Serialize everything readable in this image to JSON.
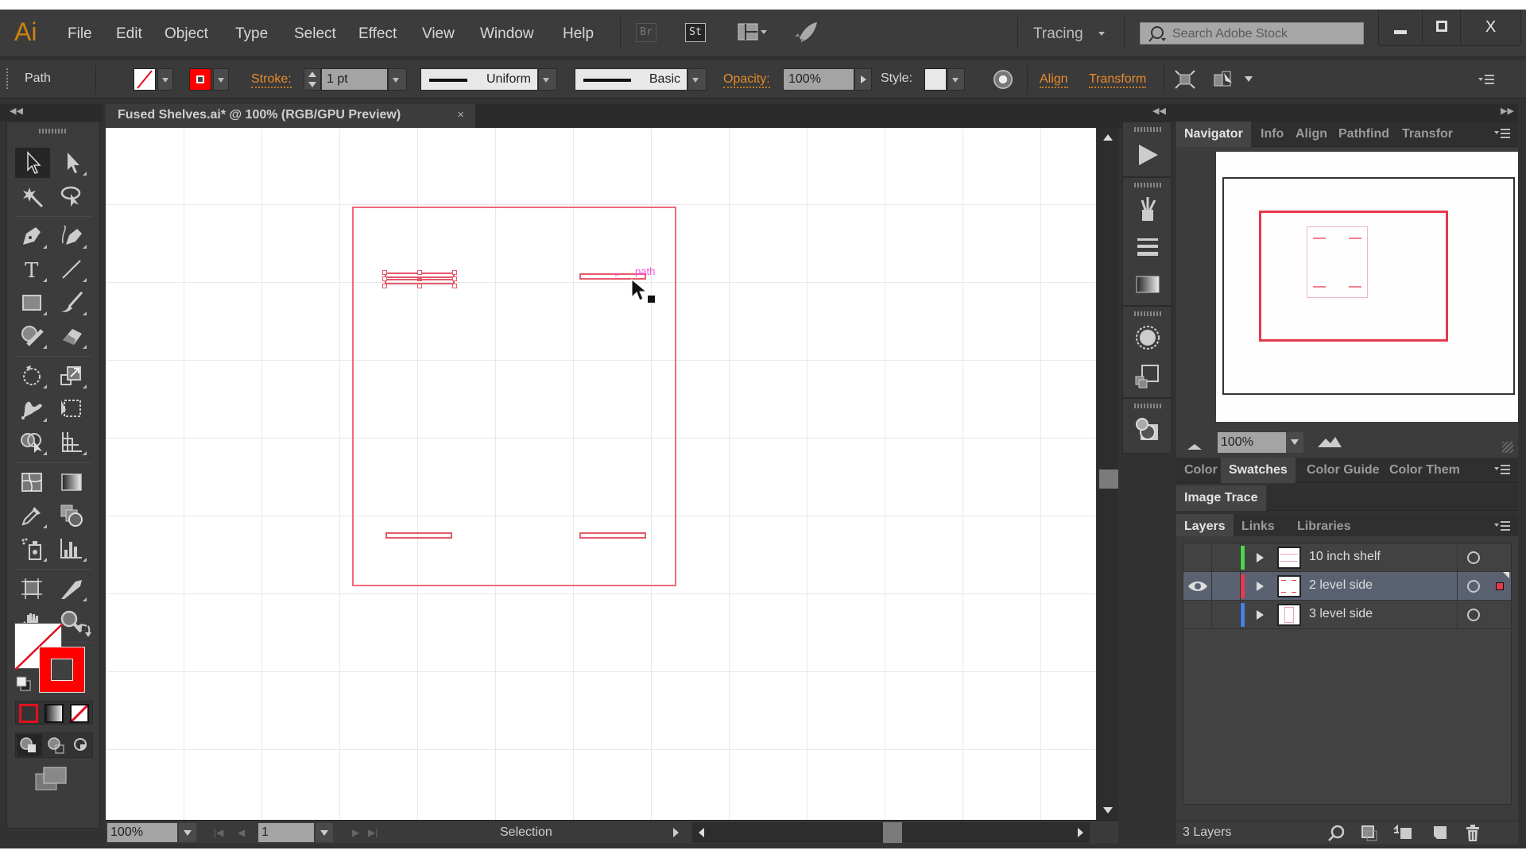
{
  "app": {
    "logo": "Ai",
    "menu": [
      "File",
      "Edit",
      "Object",
      "Type",
      "Select",
      "Effect",
      "View",
      "Window",
      "Help"
    ],
    "bridge_label": "Br",
    "stock_label": "St",
    "workspace": "Tracing",
    "search_placeholder": "Search Adobe Stock",
    "window_buttons": {
      "minimize": "▁",
      "maximize": "□",
      "close": "X"
    }
  },
  "control_bar": {
    "selection_type": "Path",
    "stroke_label": "Stroke:",
    "stroke_weight": "1 pt",
    "profile": "Uniform",
    "brush": "Basic",
    "opacity_label": "Opacity:",
    "opacity_value": "100%",
    "style_label": "Style:",
    "align_label": "Align",
    "transform_label": "Transform",
    "stroke_color": "#ff0000"
  },
  "document": {
    "tab_title": "Fused Shelves.ai* @ 100% (RGB/GPU Preview)",
    "close_glyph": "×",
    "hover_label": "path"
  },
  "tools": [
    "selection",
    "direct-selection",
    "magic-wand",
    "lasso",
    "pen",
    "curvature",
    "type",
    "line-segment",
    "rectangle",
    "paintbrush",
    "shaper",
    "eraser",
    "rotate",
    "scale",
    "puppet-warp",
    "free-transform",
    "shape-builder",
    "perspective-grid",
    "mesh",
    "gradient",
    "eyedropper",
    "blend",
    "symbol-sprayer",
    "column-graph",
    "artboard",
    "slice",
    "hand",
    "zoom"
  ],
  "status_bar": {
    "zoom": "100%",
    "page": "1",
    "status": "Selection"
  },
  "panels": {
    "top_tabs": [
      "Navigator",
      "Info",
      "Align",
      "Pathfind",
      "Transfor"
    ],
    "active_top_tab": "Navigator",
    "navigator_zoom": "100%",
    "color_tabs": [
      "Color",
      "Swatches",
      "Color Guide",
      "Color Them"
    ],
    "active_color_tab": "Swatches",
    "image_trace_tab": "Image Trace",
    "layer_tabs": [
      "Layers",
      "Links",
      "Libraries"
    ],
    "active_layer_tab": "Layers",
    "layers": [
      {
        "name": "10 inch shelf",
        "color": "#4cd64c",
        "visible": false,
        "selected": false
      },
      {
        "name": "2 level side",
        "color": "#e5394c",
        "visible": true,
        "selected": true
      },
      {
        "name": "3 level side",
        "color": "#4a7fe8",
        "visible": false,
        "selected": false
      }
    ],
    "layer_count": "3 Layers"
  }
}
